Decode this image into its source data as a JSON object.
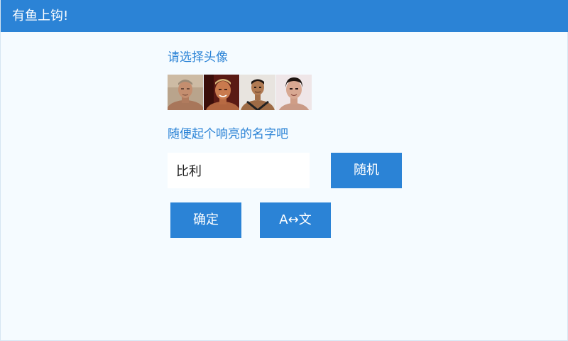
{
  "app": {
    "title": "有鱼上钩!"
  },
  "avatar_section": {
    "label": "请选择头像",
    "avatars": [
      {
        "icon": "avatar-man-1"
      },
      {
        "icon": "avatar-man-2"
      },
      {
        "icon": "avatar-man-3"
      },
      {
        "icon": "avatar-man-4"
      }
    ]
  },
  "name_section": {
    "label": "随便起个响亮的名字吧",
    "input_value": "比利",
    "random_label": "随机"
  },
  "actions": {
    "confirm_label": "确定",
    "language_label": "A↔文"
  },
  "colors": {
    "accent": "#2b83d6",
    "background": "#f5fbff"
  }
}
